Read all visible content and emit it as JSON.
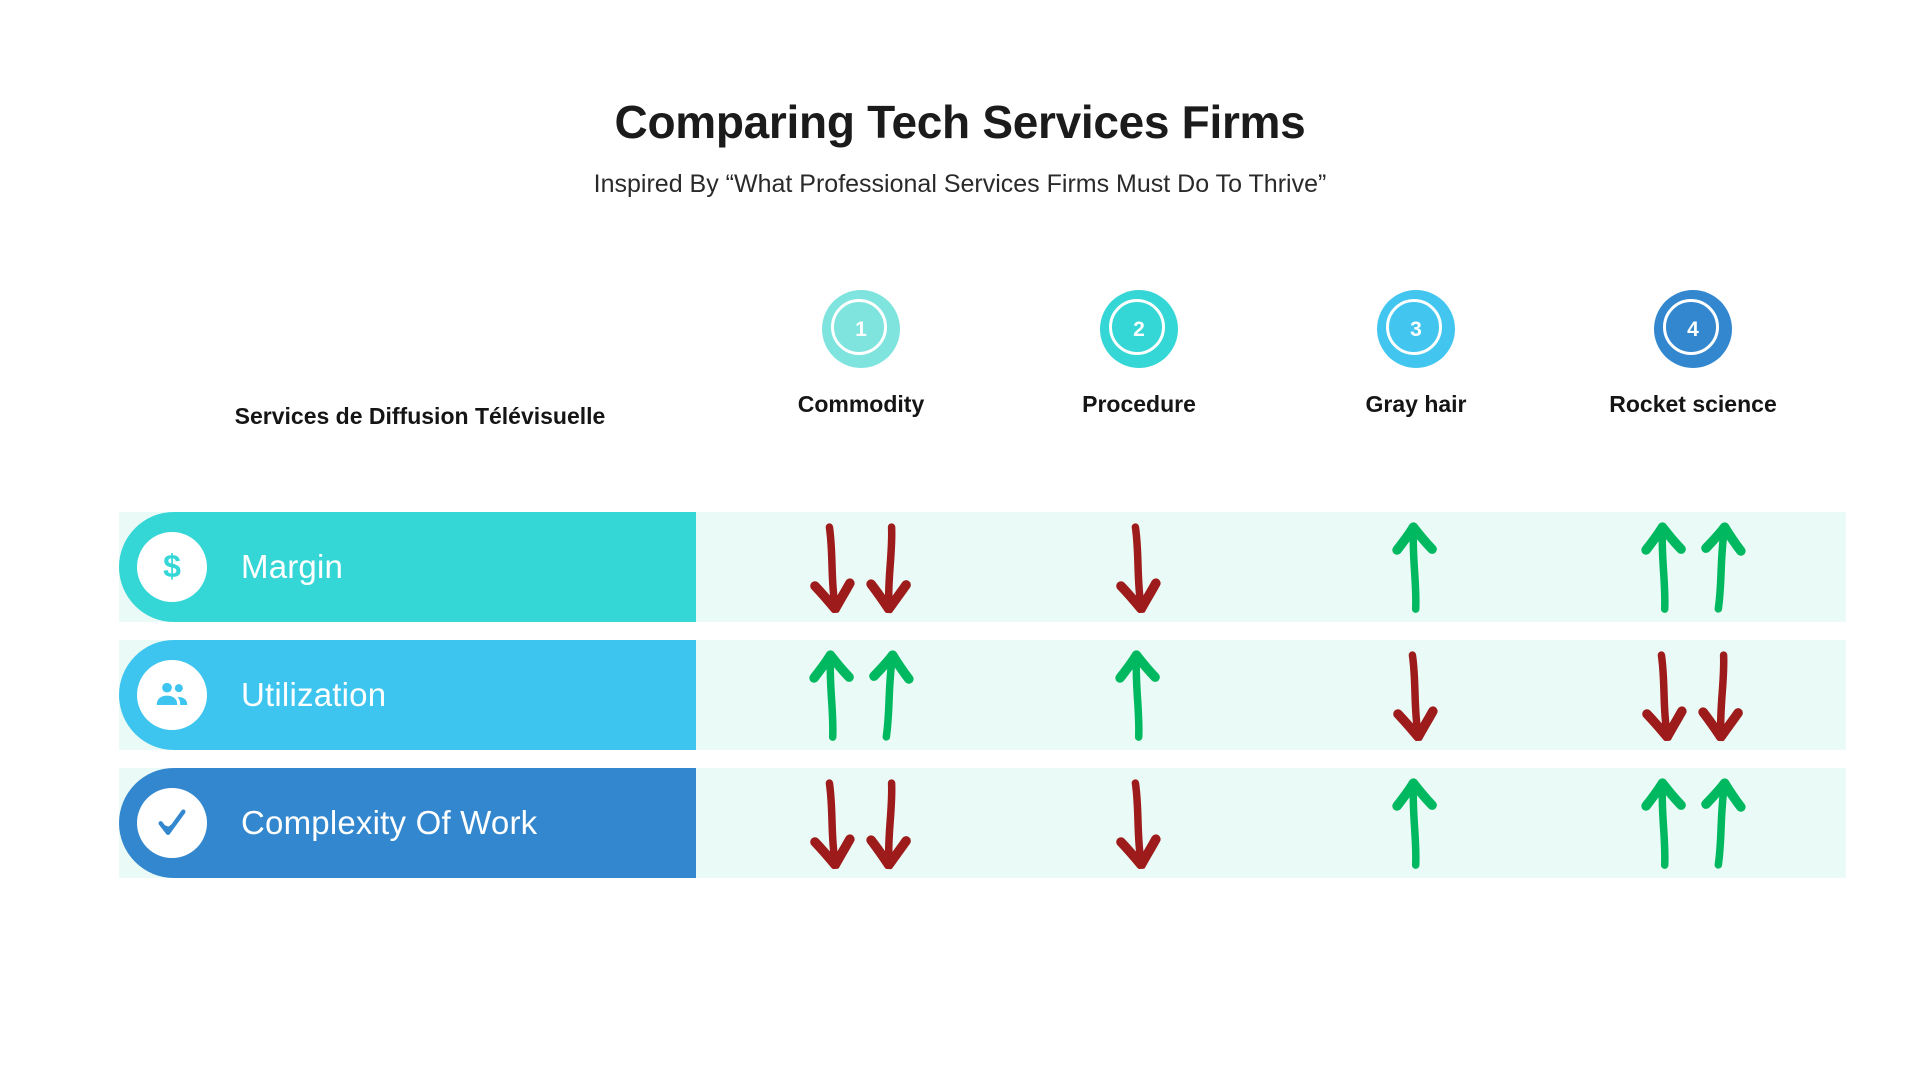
{
  "header": {
    "title": "Comparing Tech Services Firms",
    "subtitle": "Inspired By “What Professional Services Firms Must Do To Thrive”"
  },
  "row_axis_label": "Services de Diffusion Télévisuelle",
  "columns": [
    {
      "number": "1",
      "label": "Commodity",
      "color": "#7fe3de"
    },
    {
      "number": "2",
      "label": "Procedure",
      "color": "#35d6d6"
    },
    {
      "number": "3",
      "label": "Gray hair",
      "color": "#42c6f0"
    },
    {
      "number": "4",
      "label": "Rocket science",
      "color": "#3287ce"
    }
  ],
  "rows": [
    {
      "label": "Margin",
      "icon": "dollar-icon",
      "color": "#35d6d6"
    },
    {
      "label": "Utilization",
      "icon": "people-icon",
      "color": "#3ec5ef"
    },
    {
      "label": "Complexity Of Work",
      "icon": "check-icon",
      "color": "#3287ce"
    }
  ],
  "colors": {
    "band_background": "#eafaf7",
    "arrow_up": "#00b85f",
    "arrow_down": "#9e1b1b",
    "page_background": "#ffffff",
    "text": "#151515"
  },
  "chart_data": {
    "type": "table",
    "title": "Comparing Tech Services Firms",
    "subtitle": "Inspired By “What Professional Services Firms Must Do To Thrive”",
    "xlabel": "",
    "ylabel": "Services de Diffusion Télévisuelle",
    "categories": [
      "Commodity",
      "Procedure",
      "Gray hair",
      "Rocket science"
    ],
    "category_numbers": [
      "1",
      "2",
      "3",
      "4"
    ],
    "row_labels": [
      "Margin",
      "Utilization",
      "Complexity Of Work"
    ],
    "legend": [
      "up arrow = increase (green)",
      "down arrow = decrease (red)"
    ],
    "cells": [
      {
        "row": "Margin",
        "column": "Commodity",
        "direction": "down",
        "count": 2,
        "value": -2
      },
      {
        "row": "Margin",
        "column": "Procedure",
        "direction": "down",
        "count": 1,
        "value": -1
      },
      {
        "row": "Margin",
        "column": "Gray hair",
        "direction": "up",
        "count": 1,
        "value": 1
      },
      {
        "row": "Margin",
        "column": "Rocket science",
        "direction": "up",
        "count": 2,
        "value": 2
      },
      {
        "row": "Utilization",
        "column": "Commodity",
        "direction": "up",
        "count": 2,
        "value": 2
      },
      {
        "row": "Utilization",
        "column": "Procedure",
        "direction": "up",
        "count": 1,
        "value": 1
      },
      {
        "row": "Utilization",
        "column": "Gray hair",
        "direction": "down",
        "count": 1,
        "value": -1
      },
      {
        "row": "Utilization",
        "column": "Rocket science",
        "direction": "down",
        "count": 2,
        "value": -2
      },
      {
        "row": "Complexity Of Work",
        "column": "Commodity",
        "direction": "down",
        "count": 2,
        "value": -2
      },
      {
        "row": "Complexity Of Work",
        "column": "Procedure",
        "direction": "down",
        "count": 1,
        "value": -1
      },
      {
        "row": "Complexity Of Work",
        "column": "Gray hair",
        "direction": "up",
        "count": 1,
        "value": 1
      },
      {
        "row": "Complexity Of Work",
        "column": "Rocket science",
        "direction": "up",
        "count": 2,
        "value": 2
      }
    ],
    "series": [
      {
        "name": "Margin",
        "values": [
          -2,
          -1,
          1,
          2
        ]
      },
      {
        "name": "Utilization",
        "values": [
          2,
          1,
          -1,
          -2
        ]
      },
      {
        "name": "Complexity Of Work",
        "values": [
          -2,
          -1,
          1,
          2
        ]
      }
    ],
    "ylim": [
      -2,
      2
    ],
    "grid": false,
    "legend_position": "none"
  }
}
